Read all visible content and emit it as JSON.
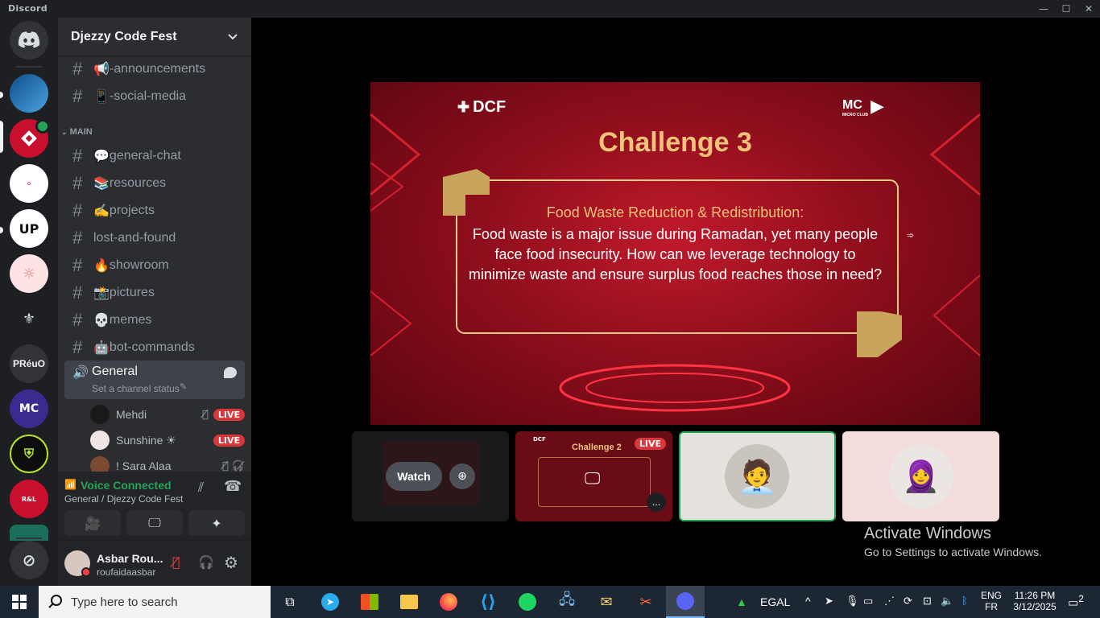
{
  "window": {
    "title": "Discord"
  },
  "servers": [
    {
      "name": "PRéuO"
    }
  ],
  "guild": {
    "name": "Djezzy Code Fest"
  },
  "channels_top": [
    {
      "emoji": "📢",
      "name": "-announcements"
    },
    {
      "emoji": "📱",
      "name": "-social-media"
    }
  ],
  "category": {
    "name": "MAIN"
  },
  "channels_main": [
    {
      "emoji": "💬",
      "name": "general-chat"
    },
    {
      "emoji": "📚",
      "name": "resources"
    },
    {
      "emoji": "✍",
      "name": "projects"
    },
    {
      "emoji": "",
      "name": "lost-and-found"
    },
    {
      "emoji": "🔥",
      "name": "showroom"
    },
    {
      "emoji": "📸",
      "name": "pictures"
    },
    {
      "emoji": "💀",
      "name": "memes"
    },
    {
      "emoji": "🤖",
      "name": "bot-commands"
    }
  ],
  "voice_channel": {
    "name": "General",
    "status": "Set a channel status"
  },
  "members": [
    {
      "name": "Mehdi",
      "live": "LIVE"
    },
    {
      "name": "Sunshine ☀",
      "live": "LIVE"
    },
    {
      "name": "! Sara Alaa",
      "live": ""
    }
  ],
  "voice_panel": {
    "status": "Voice Connected",
    "location": "General / Djezzy Code Fest"
  },
  "user": {
    "display_name": "Asbar Rou...",
    "username": "roufaidaasbar"
  },
  "slide": {
    "logo_left": "DCF",
    "logo_right": "MICRO CLUB",
    "title": "Challenge 3",
    "subtitle": "Food Waste Reduction & Redistribution:",
    "body": "Food waste is a major issue during Ramadan, yet many people face food insecurity. How can we leverage technology to minimize waste and ensure surplus food reaches those in need?"
  },
  "tiles": {
    "watch_label": "Watch",
    "preview_title": "Challenge 2",
    "preview_logo": "DCF",
    "live": "LIVE",
    "more": "..."
  },
  "activation": {
    "title": "Activate Windows",
    "subtitle": "Go to Settings to activate Windows."
  },
  "taskbar": {
    "search_placeholder": "Type here to search",
    "ticker": "EGAL",
    "lang_top": "ENG",
    "lang_bottom": "FR",
    "time": "11:26 PM",
    "date": "3/12/2025",
    "notif_count": "2"
  },
  "colors": {
    "accent_green": "#23a55a",
    "live_red": "#da373c",
    "slide_gold": "#f0c27a"
  }
}
